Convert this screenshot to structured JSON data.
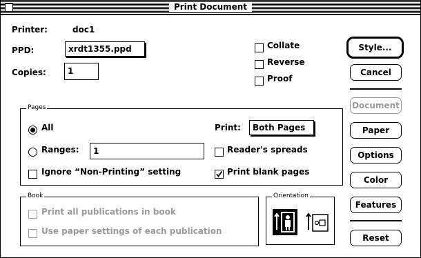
{
  "window": {
    "title": "Print Document"
  },
  "printer": {
    "label": "Printer:",
    "value": "doc1"
  },
  "ppd": {
    "label": "PPD:",
    "value": "xrdt1355.ppd"
  },
  "copies": {
    "label": "Copies:",
    "value": "1"
  },
  "options_checks": {
    "collate": {
      "label": "Collate",
      "checked": false
    },
    "reverse": {
      "label": "Reverse",
      "checked": false
    },
    "proof": {
      "label": "Proof",
      "checked": false
    }
  },
  "pages": {
    "group_label": "Pages",
    "all_label": "All",
    "ranges_label": "Ranges:",
    "ranges_value": "1",
    "selected": "All",
    "ignore_label": "Ignore “Non-Printing” setting",
    "ignore_checked": false,
    "print_label": "Print:",
    "print_value": "Both Pages",
    "readers_label": "Reader's spreads",
    "readers_checked": false,
    "blank_label": "Print blank pages",
    "blank_checked": true
  },
  "book": {
    "group_label": "Book",
    "print_all_label": "Print all publications in book",
    "use_paper_label": "Use paper settings of each publication",
    "enabled": false
  },
  "orientation": {
    "group_label": "Orientation",
    "selected": "portrait"
  },
  "buttons": {
    "style": "Style...",
    "cancel": "Cancel",
    "document": "Document",
    "paper": "Paper",
    "options": "Options",
    "color": "Color",
    "features": "Features",
    "reset": "Reset"
  }
}
